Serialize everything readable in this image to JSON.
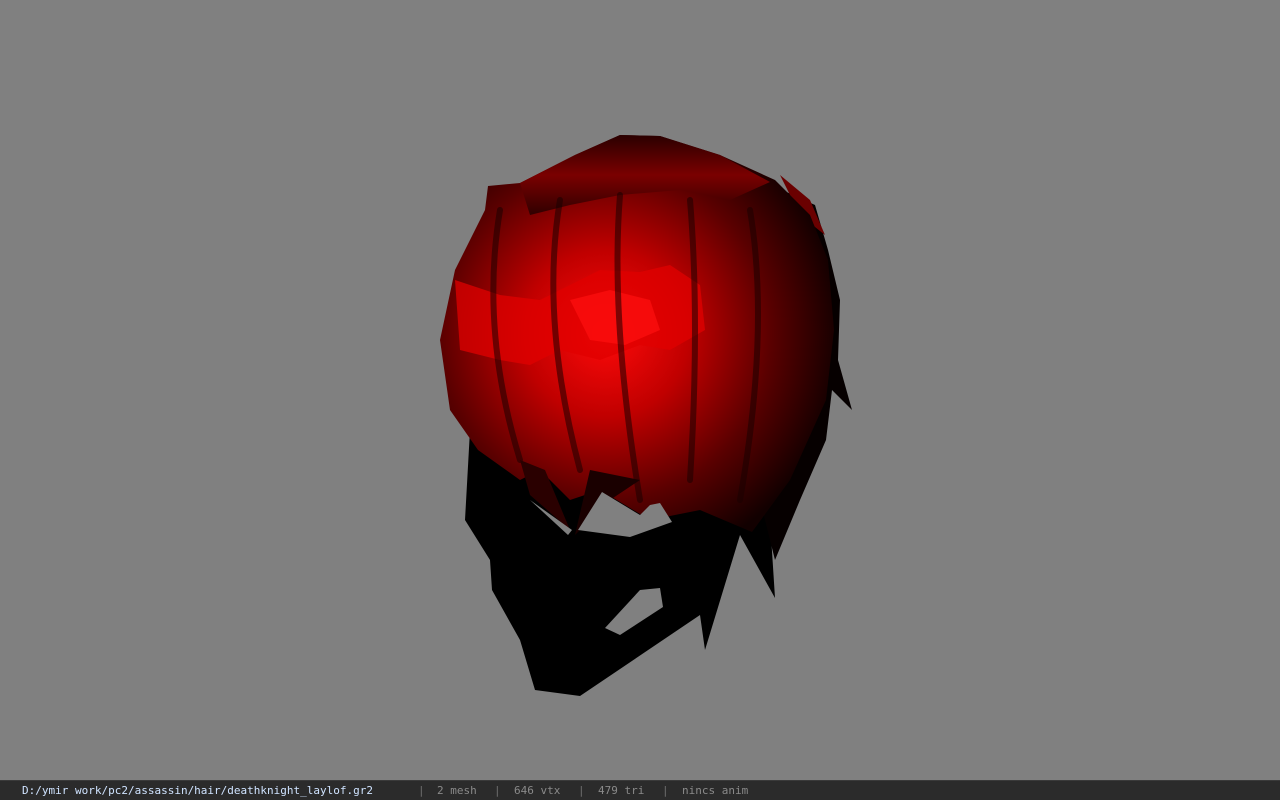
{
  "viewer": {
    "background_color": "#808080",
    "model_colors": {
      "hair_red": "#e00000",
      "hair_dark": "#3a0000",
      "shadow": "#000000"
    }
  },
  "status_bar": {
    "file_path": "D:/ymir work/pc2/assassin/hair/deathknight_laylof.gr2",
    "separator": "|",
    "mesh_count": "2 mesh",
    "vertex_count": "646 vtx",
    "triangle_count": "479 tri",
    "anim_status": "nincs anim"
  }
}
